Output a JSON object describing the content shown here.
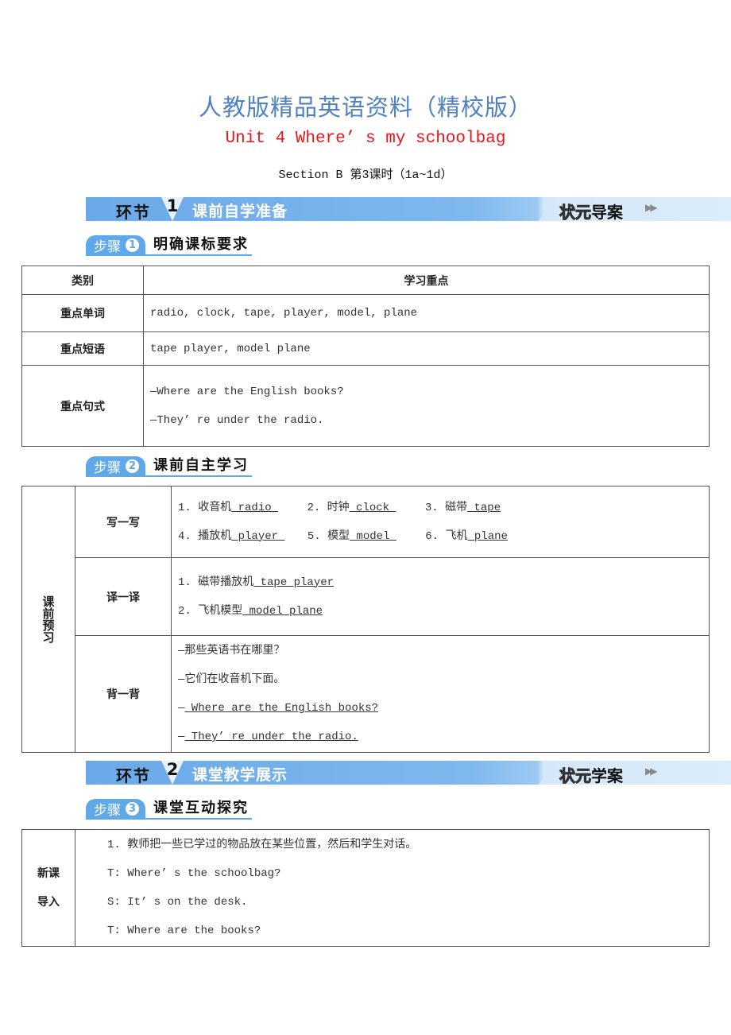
{
  "header": {
    "main_title": "人教版精品英语资料（精校版）",
    "unit_title": "Unit 4 Where’ s my schoolbag",
    "section_sub": "Section B  第3课时（1a~1d）"
  },
  "banners": [
    {
      "ring": "环节",
      "number": "1",
      "title": "课前自学准备",
      "brand_outline": "状元",
      "brand_bold": "导案",
      "arrow": "▶▶"
    },
    {
      "ring": "环节",
      "number": "2",
      "title": "课堂教学展示",
      "brand_outline": "状元",
      "brand_bold": "学案",
      "arrow": "▶▶"
    }
  ],
  "steps": [
    {
      "label": "步骤",
      "number": "1",
      "title": "明确课标要求"
    },
    {
      "label": "步骤",
      "number": "2",
      "title": "课前自主学习"
    },
    {
      "label": "步骤",
      "number": "3",
      "title": "课堂互动探究"
    }
  ],
  "table1": {
    "headers": [
      "类别",
      "学习重点"
    ],
    "rows": [
      {
        "category": "重点单词",
        "lines": [
          "radio, clock, tape, player, model, plane"
        ]
      },
      {
        "category": "重点短语",
        "lines": [
          "tape player, model plane"
        ]
      },
      {
        "category": "重点句式",
        "lines": [
          "—Where are the English books?",
          "—They’ re under the radio."
        ]
      }
    ]
  },
  "table2": {
    "group_label": "课前预习",
    "write": {
      "label": "写一写",
      "items": [
        {
          "num": "1.",
          "cn": "收音机",
          "answer": " radio "
        },
        {
          "num": "2.",
          "cn": "时钟",
          "answer": " clock "
        },
        {
          "num": "3.",
          "cn": "磁带",
          "answer": " tape"
        },
        {
          "num": "4.",
          "cn": "播放机",
          "answer": " player "
        },
        {
          "num": "5.",
          "cn": "模型",
          "answer": " model "
        },
        {
          "num": "6.",
          "cn": "飞机",
          "answer": " plane "
        }
      ]
    },
    "translate": {
      "label": "译一译",
      "items": [
        {
          "num": "1.",
          "cn": "磁带播放机",
          "answer": " tape player "
        },
        {
          "num": "2.",
          "cn": "飞机模型",
          "answer": " model plane "
        }
      ]
    },
    "recite": {
      "label": "背一背",
      "lines": [
        "—那些英语书在哪里？",
        "—它们在收音机下面。"
      ],
      "answers": [
        " Where are the English books? ",
        " They’ re under the radio. "
      ],
      "dash": "—"
    }
  },
  "table3": {
    "label_line1": "新课",
    "label_line2": "导入",
    "lines": [
      "1. 教师把一些已学过的物品放在某些位置，然后和学生对话。",
      "T: Where’ s the schoolbag?",
      "S: It’ s on the desk.",
      "T: Where are the books?"
    ]
  }
}
